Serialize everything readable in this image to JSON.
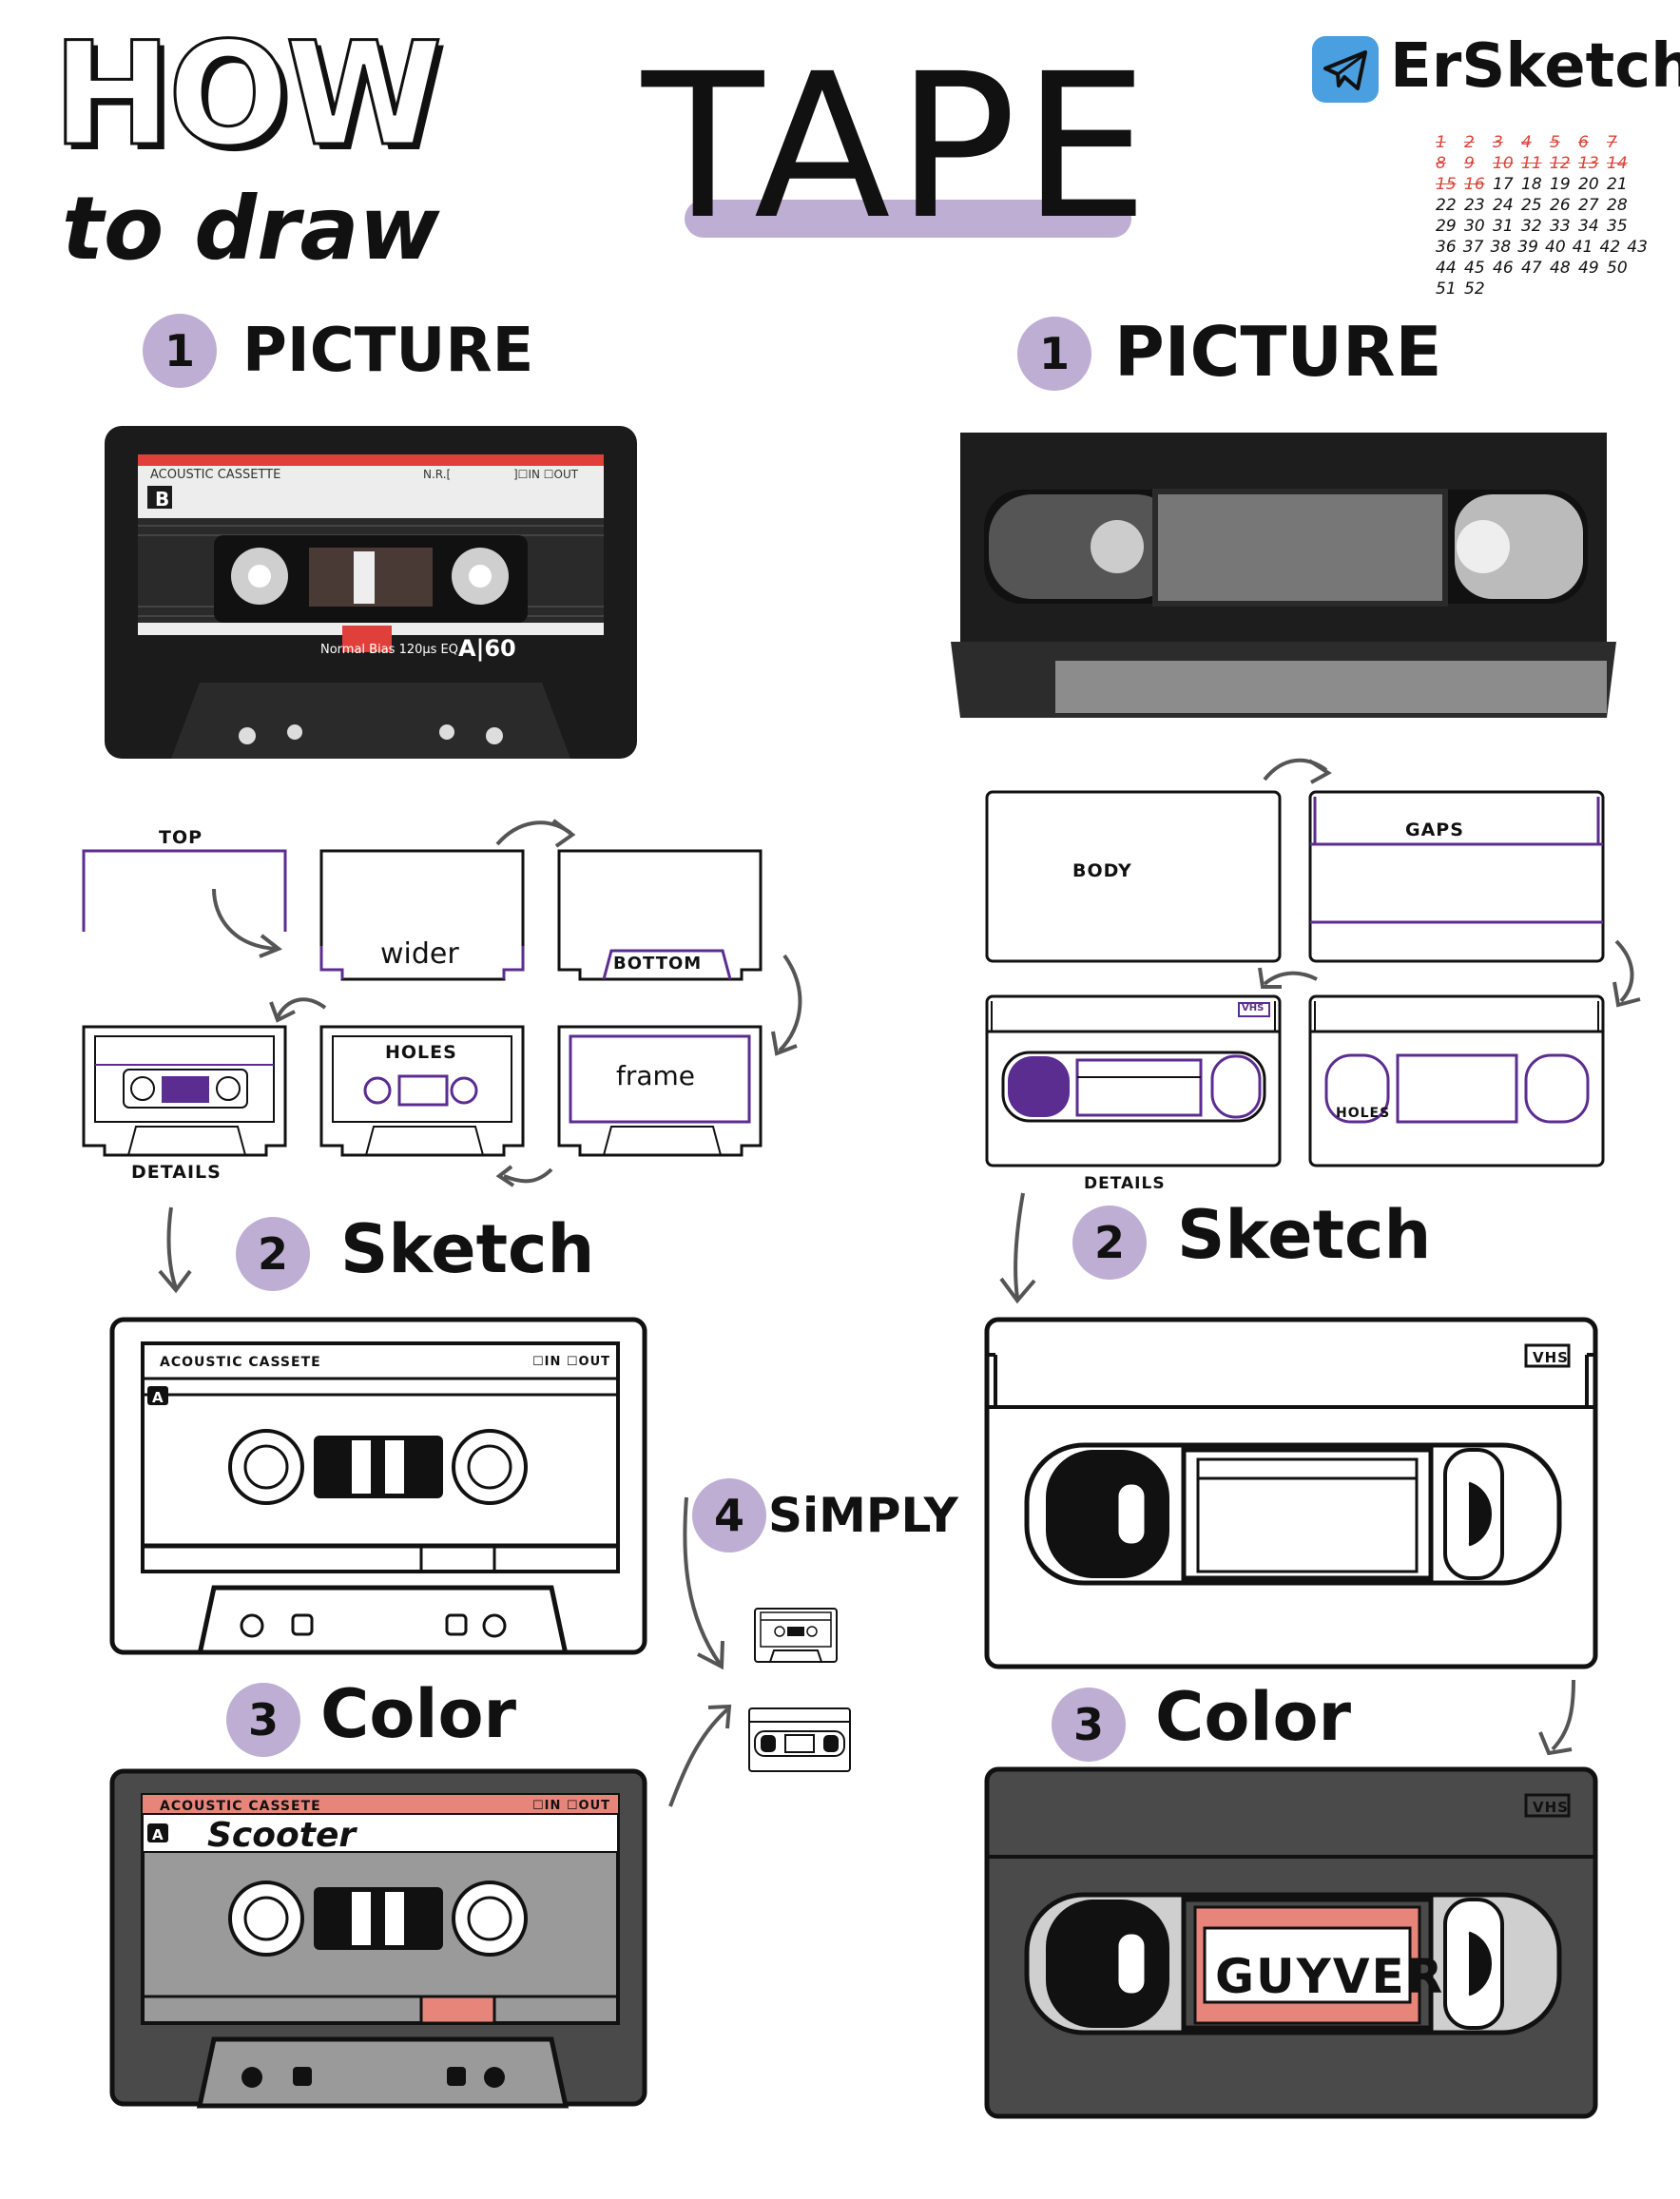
{
  "header": {
    "how": "HOW",
    "to_draw": "to draw",
    "title": "TAPE",
    "brand": "ErSketch"
  },
  "calendar": {
    "rows": [
      [
        "1",
        "2",
        "3",
        "4",
        "5",
        "6",
        "7"
      ],
      [
        "8",
        "9",
        "10",
        "11",
        "12",
        "13",
        "14"
      ],
      [
        "15",
        "16",
        "17",
        "18",
        "19",
        "20",
        "21"
      ],
      [
        "22",
        "23",
        "24",
        "25",
        "26",
        "27",
        "28"
      ],
      [
        "29",
        "30",
        "31",
        "32",
        "33",
        "34",
        "35"
      ],
      [
        "36",
        "37",
        "38",
        "39",
        "40",
        "41",
        "42",
        "43"
      ],
      [
        "44",
        "45",
        "46",
        "47",
        "48",
        "49",
        "50"
      ],
      [
        "51",
        "52"
      ]
    ],
    "crossed_count": 16
  },
  "left": {
    "step1": {
      "num": "1",
      "label": "PICTURE"
    },
    "photo": {
      "label": "ACOUSTIC CASSETTE",
      "nr": "N.R.[",
      "inout": "]☐IN ☐OUT",
      "side": "B",
      "bias": "Normal Bias 120μs EQ",
      "model": "A|60"
    },
    "steps": {
      "top": "TOP",
      "wider": "wider",
      "bottom": "BOTTOM",
      "holes": "HOLES",
      "frame": "frame",
      "details": "DETAILS"
    },
    "step2": {
      "num": "2",
      "label": "Sketch"
    },
    "sketch": {
      "label": "ACOUSTIC CASSETE",
      "inout": "☐IN ☐OUT",
      "side": "A"
    },
    "step3": {
      "num": "3",
      "label": "Color"
    },
    "color": {
      "label": "ACOUSTIC CASSETE",
      "inout": "☐IN ☐OUT",
      "side": "A",
      "title": "Scooter"
    },
    "step4": {
      "num": "4",
      "label": "SiMPLY"
    }
  },
  "right": {
    "step1": {
      "num": "1",
      "label": "PICTURE"
    },
    "steps": {
      "body": "BODY",
      "gaps": "GAPS",
      "holes": "HOLES",
      "details": "DETAILS",
      "vhs": "VHS"
    },
    "step2": {
      "num": "2",
      "label": "Sketch"
    },
    "sketch": {
      "vhs": "VHS"
    },
    "step3": {
      "num": "3",
      "label": "Color"
    },
    "color": {
      "vhs": "VHS",
      "title": "GUYVER"
    }
  },
  "colors": {
    "accent": "#bfaed3",
    "purple": "#5b2d91",
    "salmon": "#e8857a",
    "dark_gray": "#4a4a4a",
    "mid_gray": "#9a9a9a",
    "light_gray": "#cfcfcf",
    "telegram": "#4a9fe0"
  }
}
